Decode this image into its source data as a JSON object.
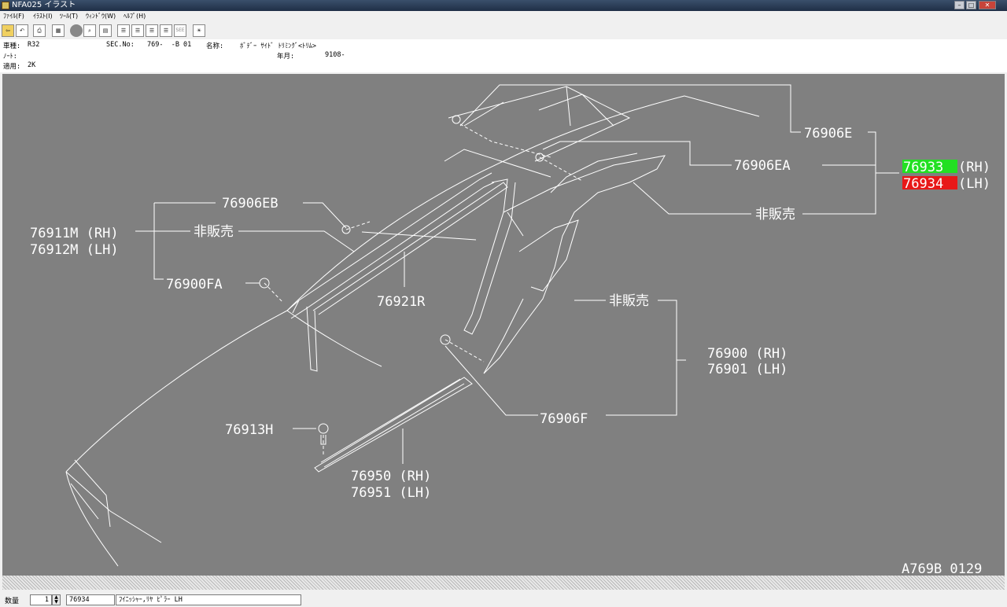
{
  "window": {
    "title": "NFA025 イラスト"
  },
  "menu": {
    "file": "ﾌｧｲﾙ(F)",
    "illust": "ｲﾗｽﾄ(I)",
    "tool": "ﾂｰﾙ(T)",
    "window": "ｳｨﾝﾄﾞｳ(W)",
    "help": "ﾍﾙﾌﾟ(H)"
  },
  "toolbar": {
    "see_label": "SEE"
  },
  "info": {
    "model_label": "車種:",
    "model_value": "R32",
    "secno_label": "SEC.No:",
    "secno_value": "769-  -B 01",
    "name_label": "名称:",
    "name_value": "ﾎﾞﾃﾞｰ ｻｲﾄﾞ ﾄﾘﾐﾝｸﾞ<ﾄﾘﾑ>",
    "note_label": "ﾉｰﾄ:",
    "date_label": "年月:",
    "date_value": "9108-",
    "apply_label": "適用:",
    "apply_value": "2K"
  },
  "parts": {
    "p76906E": "76906E",
    "p76906EA": "76906EA",
    "p76933": "76933",
    "rh1": "(RH)",
    "p76934": "76934",
    "lh1": "(LH)",
    "hihanbai": "非販売",
    "p76906EB": "76906EB",
    "p76911M": "76911M (RH)",
    "p76912M": "76912M (LH)",
    "p76900FA": "76900FA",
    "p76921R": "76921R",
    "p76900": "76900 (RH)",
    "p76901": "76901 (LH)",
    "p76906F": "76906F",
    "p76913H": "76913H",
    "p76950": "76950 (RH)",
    "p76951": "76951 (LH)",
    "illust_id": "A769B 0129"
  },
  "colors": {
    "highlight_green": "#22e022",
    "highlight_red": "#e81818"
  },
  "status": {
    "qty_label": "数量",
    "qty_value": "1",
    "part_no": "76934",
    "part_name": "ﾌｲﾆｯｼｬｰ,ﾘﾔ ﾋﾟﾗｰ LH"
  }
}
